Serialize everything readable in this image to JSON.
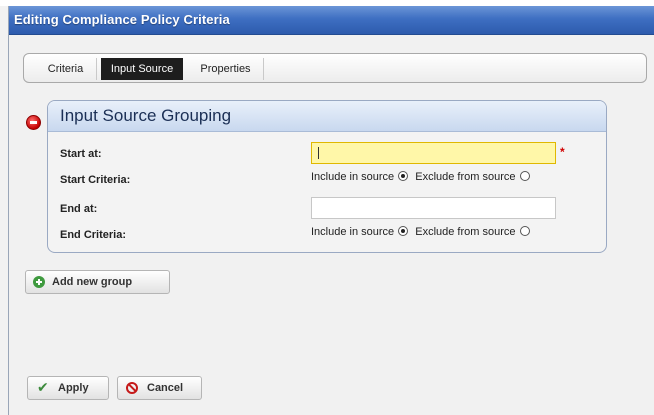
{
  "window": {
    "title": "Editing Compliance Policy Criteria"
  },
  "tabs": [
    {
      "label": "Criteria",
      "selected": false
    },
    {
      "label": "Input Source",
      "selected": true
    },
    {
      "label": "Properties",
      "selected": false
    }
  ],
  "group": {
    "title": "Input Source Grouping",
    "start_at": {
      "label": "Start at:",
      "value": "",
      "required": true
    },
    "start_criteria": {
      "label": "Start Criteria:",
      "options": [
        {
          "label": "Include in source",
          "selected": true
        },
        {
          "label": "Exclude from source",
          "selected": false
        }
      ]
    },
    "end_at": {
      "label": "End at:",
      "value": ""
    },
    "end_criteria": {
      "label": "End Criteria:",
      "options": [
        {
          "label": "Include in source",
          "selected": true
        },
        {
          "label": "Exclude from source",
          "selected": false
        }
      ]
    },
    "required_marker": "*"
  },
  "buttons": {
    "add_group": "Add new group",
    "apply": "Apply",
    "cancel": "Cancel"
  },
  "icons": {
    "remove": "remove-icon",
    "add": "plus-icon",
    "apply": "check-icon",
    "cancel": "cancel-icon"
  },
  "colors": {
    "titlebar": "#3e6fc2",
    "active_field": "#fff7a8",
    "required": "#d00000",
    "selected_tab": "#1d1d1d"
  }
}
